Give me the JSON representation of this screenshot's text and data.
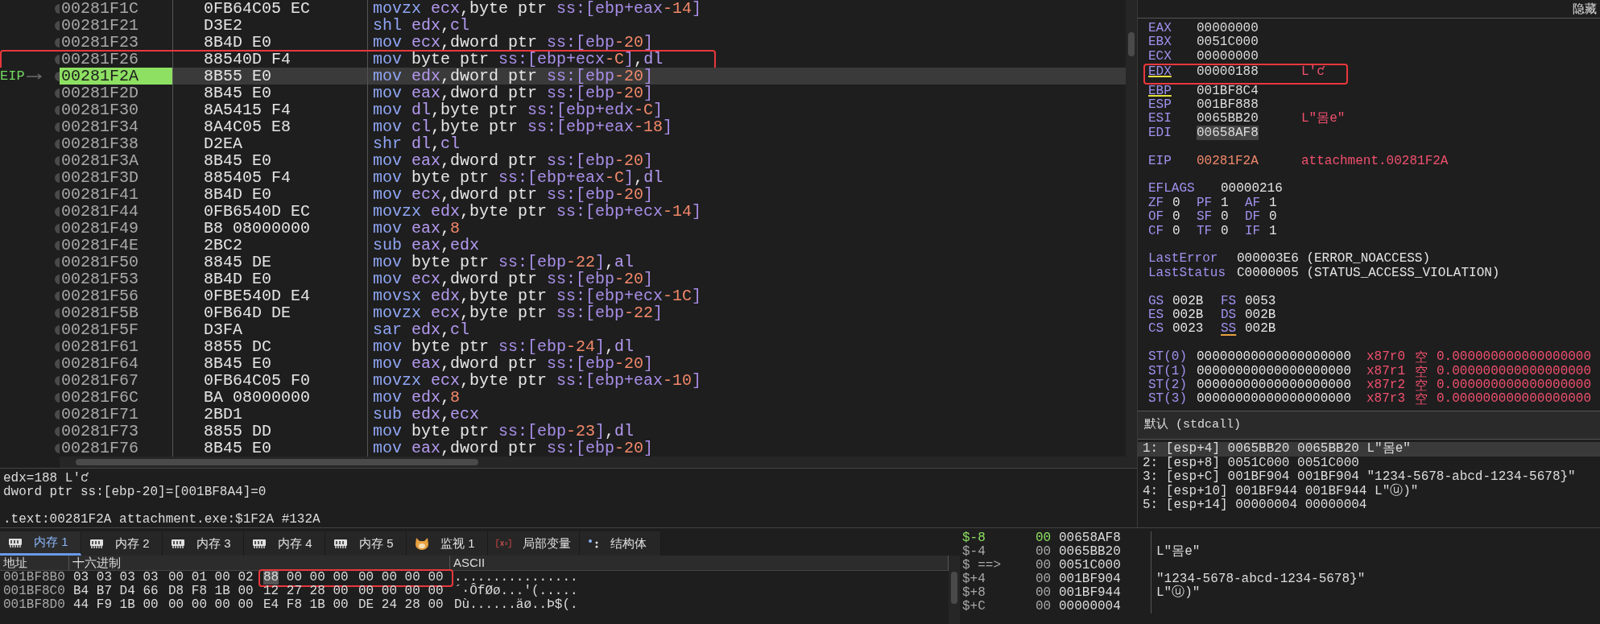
{
  "disassembly": {
    "ip_label": "EIP",
    "rows": [
      {
        "address": "00281F1C",
        "bytes": "0FB64C05 EC",
        "current": false,
        "annotated": false,
        "instruction": [
          {
            "kind": "m",
            "text": "movzx "
          },
          {
            "kind": "r",
            "text": "ecx"
          },
          {
            "kind": "p",
            "text": ",byte ptr "
          },
          {
            "kind": "s",
            "text": "ss:[ebp+eax"
          },
          {
            "kind": "n",
            "text": "-14"
          },
          {
            "kind": "s",
            "text": "]"
          }
        ]
      },
      {
        "address": "00281F21",
        "bytes": "D3E2",
        "current": false,
        "annotated": false,
        "instruction": [
          {
            "kind": "m",
            "text": "shl "
          },
          {
            "kind": "r",
            "text": "edx"
          },
          {
            "kind": "p",
            "text": ","
          },
          {
            "kind": "r",
            "text": "cl"
          }
        ]
      },
      {
        "address": "00281F23",
        "bytes": "8B4D E0",
        "current": false,
        "annotated": false,
        "instruction": [
          {
            "kind": "m",
            "text": "mov "
          },
          {
            "kind": "r",
            "text": "ecx"
          },
          {
            "kind": "p",
            "text": ",dword ptr "
          },
          {
            "kind": "s",
            "text": "ss:[ebp"
          },
          {
            "kind": "n",
            "text": "-20"
          },
          {
            "kind": "s",
            "text": "]"
          }
        ]
      },
      {
        "address": "00281F26",
        "bytes": "88540D F4",
        "current": false,
        "annotated": true,
        "instruction": [
          {
            "kind": "m",
            "text": "mov "
          },
          {
            "kind": "p",
            "text": "byte ptr "
          },
          {
            "kind": "s",
            "text": "ss:[ebp+ecx"
          },
          {
            "kind": "n",
            "text": "-C"
          },
          {
            "kind": "s",
            "text": "]"
          },
          {
            "kind": "p",
            "text": ","
          },
          {
            "kind": "r",
            "text": "dl"
          }
        ]
      },
      {
        "address": "00281F2A",
        "bytes": "8B55 E0",
        "current": true,
        "annotated": false,
        "instruction": [
          {
            "kind": "m",
            "text": "mov "
          },
          {
            "kind": "r",
            "text": "edx"
          },
          {
            "kind": "p",
            "text": ",dword ptr "
          },
          {
            "kind": "s",
            "text": "ss:[ebp"
          },
          {
            "kind": "n",
            "text": "-20"
          },
          {
            "kind": "s",
            "text": "]"
          }
        ]
      },
      {
        "address": "00281F2D",
        "bytes": "8B45 E0",
        "current": false,
        "annotated": false,
        "instruction": [
          {
            "kind": "m",
            "text": "mov "
          },
          {
            "kind": "r",
            "text": "eax"
          },
          {
            "kind": "p",
            "text": ",dword ptr "
          },
          {
            "kind": "s",
            "text": "ss:[ebp"
          },
          {
            "kind": "n",
            "text": "-20"
          },
          {
            "kind": "s",
            "text": "]"
          }
        ]
      },
      {
        "address": "00281F30",
        "bytes": "8A5415 F4",
        "current": false,
        "annotated": false,
        "instruction": [
          {
            "kind": "m",
            "text": "mov "
          },
          {
            "kind": "r",
            "text": "dl"
          },
          {
            "kind": "p",
            "text": ",byte ptr "
          },
          {
            "kind": "s",
            "text": "ss:[ebp+edx"
          },
          {
            "kind": "n",
            "text": "-C"
          },
          {
            "kind": "s",
            "text": "]"
          }
        ]
      },
      {
        "address": "00281F34",
        "bytes": "8A4C05 E8",
        "current": false,
        "annotated": false,
        "instruction": [
          {
            "kind": "m",
            "text": "mov "
          },
          {
            "kind": "r",
            "text": "cl"
          },
          {
            "kind": "p",
            "text": ",byte ptr "
          },
          {
            "kind": "s",
            "text": "ss:[ebp+eax"
          },
          {
            "kind": "n",
            "text": "-18"
          },
          {
            "kind": "s",
            "text": "]"
          }
        ]
      },
      {
        "address": "00281F38",
        "bytes": "D2EA",
        "current": false,
        "annotated": false,
        "instruction": [
          {
            "kind": "m",
            "text": "shr "
          },
          {
            "kind": "r",
            "text": "dl"
          },
          {
            "kind": "p",
            "text": ","
          },
          {
            "kind": "r",
            "text": "cl"
          }
        ]
      },
      {
        "address": "00281F3A",
        "bytes": "8B45 E0",
        "current": false,
        "annotated": false,
        "instruction": [
          {
            "kind": "m",
            "text": "mov "
          },
          {
            "kind": "r",
            "text": "eax"
          },
          {
            "kind": "p",
            "text": ",dword ptr "
          },
          {
            "kind": "s",
            "text": "ss:[ebp"
          },
          {
            "kind": "n",
            "text": "-20"
          },
          {
            "kind": "s",
            "text": "]"
          }
        ]
      },
      {
        "address": "00281F3D",
        "bytes": "885405 F4",
        "current": false,
        "annotated": false,
        "instruction": [
          {
            "kind": "m",
            "text": "mov "
          },
          {
            "kind": "p",
            "text": "byte ptr "
          },
          {
            "kind": "s",
            "text": "ss:[ebp+eax"
          },
          {
            "kind": "n",
            "text": "-C"
          },
          {
            "kind": "s",
            "text": "]"
          },
          {
            "kind": "p",
            "text": ","
          },
          {
            "kind": "r",
            "text": "dl"
          }
        ]
      },
      {
        "address": "00281F41",
        "bytes": "8B4D E0",
        "current": false,
        "annotated": false,
        "instruction": [
          {
            "kind": "m",
            "text": "mov "
          },
          {
            "kind": "r",
            "text": "ecx"
          },
          {
            "kind": "p",
            "text": ",dword ptr "
          },
          {
            "kind": "s",
            "text": "ss:[ebp"
          },
          {
            "kind": "n",
            "text": "-20"
          },
          {
            "kind": "s",
            "text": "]"
          }
        ]
      },
      {
        "address": "00281F44",
        "bytes": "0FB6540D EC",
        "current": false,
        "annotated": false,
        "instruction": [
          {
            "kind": "m",
            "text": "movzx "
          },
          {
            "kind": "r",
            "text": "edx"
          },
          {
            "kind": "p",
            "text": ",byte ptr "
          },
          {
            "kind": "s",
            "text": "ss:[ebp+ecx"
          },
          {
            "kind": "n",
            "text": "-14"
          },
          {
            "kind": "s",
            "text": "]"
          }
        ]
      },
      {
        "address": "00281F49",
        "bytes": "B8 08000000",
        "current": false,
        "annotated": false,
        "instruction": [
          {
            "kind": "m",
            "text": "mov "
          },
          {
            "kind": "r",
            "text": "eax"
          },
          {
            "kind": "p",
            "text": ","
          },
          {
            "kind": "n",
            "text": "8"
          }
        ]
      },
      {
        "address": "00281F4E",
        "bytes": "2BC2",
        "current": false,
        "annotated": false,
        "instruction": [
          {
            "kind": "m",
            "text": "sub "
          },
          {
            "kind": "r",
            "text": "eax"
          },
          {
            "kind": "p",
            "text": ","
          },
          {
            "kind": "r",
            "text": "edx"
          }
        ]
      },
      {
        "address": "00281F50",
        "bytes": "8845 DE",
        "current": false,
        "annotated": false,
        "instruction": [
          {
            "kind": "m",
            "text": "mov "
          },
          {
            "kind": "p",
            "text": "byte ptr "
          },
          {
            "kind": "s",
            "text": "ss:[ebp"
          },
          {
            "kind": "n",
            "text": "-22"
          },
          {
            "kind": "s",
            "text": "]"
          },
          {
            "kind": "p",
            "text": ","
          },
          {
            "kind": "r",
            "text": "al"
          }
        ]
      },
      {
        "address": "00281F53",
        "bytes": "8B4D E0",
        "current": false,
        "annotated": false,
        "instruction": [
          {
            "kind": "m",
            "text": "mov "
          },
          {
            "kind": "r",
            "text": "ecx"
          },
          {
            "kind": "p",
            "text": ",dword ptr "
          },
          {
            "kind": "s",
            "text": "ss:[ebp"
          },
          {
            "kind": "n",
            "text": "-20"
          },
          {
            "kind": "s",
            "text": "]"
          }
        ]
      },
      {
        "address": "00281F56",
        "bytes": "0FBE540D E4",
        "current": false,
        "annotated": false,
        "instruction": [
          {
            "kind": "m",
            "text": "movsx "
          },
          {
            "kind": "r",
            "text": "edx"
          },
          {
            "kind": "p",
            "text": ",byte ptr "
          },
          {
            "kind": "s",
            "text": "ss:[ebp+ecx"
          },
          {
            "kind": "n",
            "text": "-1C"
          },
          {
            "kind": "s",
            "text": "]"
          }
        ]
      },
      {
        "address": "00281F5B",
        "bytes": "0FB64D DE",
        "current": false,
        "annotated": false,
        "instruction": [
          {
            "kind": "m",
            "text": "movzx "
          },
          {
            "kind": "r",
            "text": "ecx"
          },
          {
            "kind": "p",
            "text": ",byte ptr "
          },
          {
            "kind": "s",
            "text": "ss:[ebp"
          },
          {
            "kind": "n",
            "text": "-22"
          },
          {
            "kind": "s",
            "text": "]"
          }
        ]
      },
      {
        "address": "00281F5F",
        "bytes": "D3FA",
        "current": false,
        "annotated": false,
        "instruction": [
          {
            "kind": "m",
            "text": "sar "
          },
          {
            "kind": "r",
            "text": "edx"
          },
          {
            "kind": "p",
            "text": ","
          },
          {
            "kind": "r",
            "text": "cl"
          }
        ]
      },
      {
        "address": "00281F61",
        "bytes": "8855 DC",
        "current": false,
        "annotated": false,
        "instruction": [
          {
            "kind": "m",
            "text": "mov "
          },
          {
            "kind": "p",
            "text": "byte ptr "
          },
          {
            "kind": "s",
            "text": "ss:[ebp"
          },
          {
            "kind": "n",
            "text": "-24"
          },
          {
            "kind": "s",
            "text": "]"
          },
          {
            "kind": "p",
            "text": ","
          },
          {
            "kind": "r",
            "text": "dl"
          }
        ]
      },
      {
        "address": "00281F64",
        "bytes": "8B45 E0",
        "current": false,
        "annotated": false,
        "instruction": [
          {
            "kind": "m",
            "text": "mov "
          },
          {
            "kind": "r",
            "text": "eax"
          },
          {
            "kind": "p",
            "text": ",dword ptr "
          },
          {
            "kind": "s",
            "text": "ss:[ebp"
          },
          {
            "kind": "n",
            "text": "-20"
          },
          {
            "kind": "s",
            "text": "]"
          }
        ]
      },
      {
        "address": "00281F67",
        "bytes": "0FB64C05 F0",
        "current": false,
        "annotated": false,
        "instruction": [
          {
            "kind": "m",
            "text": "movzx "
          },
          {
            "kind": "r",
            "text": "ecx"
          },
          {
            "kind": "p",
            "text": ",byte ptr "
          },
          {
            "kind": "s",
            "text": "ss:[ebp+eax"
          },
          {
            "kind": "n",
            "text": "-10"
          },
          {
            "kind": "s",
            "text": "]"
          }
        ]
      },
      {
        "address": "00281F6C",
        "bytes": "BA 08000000",
        "current": false,
        "annotated": false,
        "instruction": [
          {
            "kind": "m",
            "text": "mov "
          },
          {
            "kind": "r",
            "text": "edx"
          },
          {
            "kind": "p",
            "text": ","
          },
          {
            "kind": "n",
            "text": "8"
          }
        ]
      },
      {
        "address": "00281F71",
        "bytes": "2BD1",
        "current": false,
        "annotated": false,
        "instruction": [
          {
            "kind": "m",
            "text": "sub "
          },
          {
            "kind": "r",
            "text": "edx"
          },
          {
            "kind": "p",
            "text": ","
          },
          {
            "kind": "r",
            "text": "ecx"
          }
        ]
      },
      {
        "address": "00281F73",
        "bytes": "8855 DD",
        "current": false,
        "annotated": false,
        "instruction": [
          {
            "kind": "m",
            "text": "mov "
          },
          {
            "kind": "p",
            "text": "byte ptr "
          },
          {
            "kind": "s",
            "text": "ss:[ebp"
          },
          {
            "kind": "n",
            "text": "-23"
          },
          {
            "kind": "s",
            "text": "]"
          },
          {
            "kind": "p",
            "text": ","
          },
          {
            "kind": "r",
            "text": "dl"
          }
        ]
      },
      {
        "address": "00281F76",
        "bytes": "8B45 E0",
        "current": false,
        "annotated": false,
        "instruction": [
          {
            "kind": "m",
            "text": "mov "
          },
          {
            "kind": "r",
            "text": "eax"
          },
          {
            "kind": "p",
            "text": ",dword ptr "
          },
          {
            "kind": "s",
            "text": "ss:[ebp"
          },
          {
            "kind": "n",
            "text": "-20"
          },
          {
            "kind": "s",
            "text": "]"
          }
        ]
      }
    ]
  },
  "info": {
    "lines": [
      "edx=188 L'ƈ",
      "dword ptr ss:[ebp-20]=[001BF8A4]=0"
    ],
    "location": ".text:00281F2A attachment.exe:$1F2A #132A"
  },
  "registers": {
    "hide_button": "隐藏",
    "general": [
      {
        "name": "EAX",
        "value": "00000000",
        "underlined": false,
        "highlighted": false,
        "annotated": false
      },
      {
        "name": "EBX",
        "value": "0051C000",
        "underlined": false,
        "highlighted": false,
        "annotated": false
      },
      {
        "name": "ECX",
        "value": "00000000",
        "underlined": false,
        "highlighted": false,
        "annotated": false
      },
      {
        "name": "EDX",
        "value": "00000188",
        "comment": "L'ƈ",
        "underlined": true,
        "highlighted": false,
        "annotated": true
      },
      {
        "name": "EBP",
        "value": "001BF8C4",
        "underlined": true,
        "highlighted": false,
        "annotated": false
      },
      {
        "name": "ESP",
        "value": "001BF888",
        "underlined": false,
        "highlighted": false,
        "annotated": false
      },
      {
        "name": "ESI",
        "value": "0065BB20",
        "comment": "L\"몸e\"",
        "underlined": false,
        "highlighted": false,
        "annotated": false
      },
      {
        "name": "EDI",
        "value": "00658AF8",
        "underlined": false,
        "highlighted": true,
        "annotated": false
      }
    ],
    "eip": {
      "name": "EIP",
      "value": "00281F2A",
      "comment": "attachment.00281F2A"
    },
    "eflags": {
      "name": "EFLAGS",
      "value": "00000216",
      "flags": [
        {
          "name": "ZF",
          "value": "0"
        },
        {
          "name": "PF",
          "value": "1"
        },
        {
          "name": "AF",
          "value": "1"
        },
        {
          "name": "OF",
          "value": "0"
        },
        {
          "name": "SF",
          "value": "0"
        },
        {
          "name": "DF",
          "value": "0"
        },
        {
          "name": "CF",
          "value": "0"
        },
        {
          "name": "TF",
          "value": "0"
        },
        {
          "name": "IF",
          "value": "1"
        }
      ]
    },
    "status": [
      {
        "name": "LastError",
        "value": "000003E6 (ERROR_NOACCESS)"
      },
      {
        "name": "LastStatus",
        "value": "C0000005 (STATUS_ACCESS_VIOLATION)"
      }
    ],
    "segments": [
      {
        "name": "GS",
        "value": "002B",
        "underlined": false
      },
      {
        "name": "FS",
        "value": "0053",
        "underlined": false
      },
      {
        "name": "ES",
        "value": "002B",
        "underlined": false
      },
      {
        "name": "DS",
        "value": "002B",
        "underlined": false
      },
      {
        "name": "CS",
        "value": "0023",
        "underlined": false
      },
      {
        "name": "SS",
        "value": "002B",
        "underlined": true
      }
    ],
    "fpu": [
      {
        "name": "ST(0)",
        "value": "00000000000000000000",
        "tag": "x87r0",
        "state": "空",
        "float": "0.000000000000000000"
      },
      {
        "name": "ST(1)",
        "value": "00000000000000000000",
        "tag": "x87r1",
        "state": "空",
        "float": "0.000000000000000000"
      },
      {
        "name": "ST(2)",
        "value": "00000000000000000000",
        "tag": "x87r2",
        "state": "空",
        "float": "0.000000000000000000"
      },
      {
        "name": "ST(3)",
        "value": "00000000000000000000",
        "tag": "x87r3",
        "state": "空",
        "float": "0.000000000000000000"
      }
    ]
  },
  "call_stack": {
    "convention": "默认 (stdcall)",
    "args": [
      {
        "text": "1: [esp+4] 0065BB20 0065BB20 L\"몸e\"",
        "selected": true
      },
      {
        "text": "2: [esp+8] 0051C000 0051C000",
        "selected": false
      },
      {
        "text": "3: [esp+C] 001BF904 001BF904 \"1234-5678-abcd-1234-5678}\"",
        "selected": false
      },
      {
        "text": "4: [esp+10] 001BF944 001BF944 L\"ⓤ)\"",
        "selected": false
      },
      {
        "text": "5: [esp+14] 00000004 00000004",
        "selected": false
      }
    ]
  },
  "memory": {
    "tabs": [
      {
        "label": "内存 1",
        "kind": "memory",
        "selected": true
      },
      {
        "label": "内存 2",
        "kind": "memory",
        "selected": false
      },
      {
        "label": "内存 3",
        "kind": "memory",
        "selected": false
      },
      {
        "label": "内存 4",
        "kind": "memory",
        "selected": false
      },
      {
        "label": "内存 5",
        "kind": "memory",
        "selected": false
      },
      {
        "label": "监视 1",
        "kind": "watch",
        "selected": false
      },
      {
        "label": "局部变量",
        "kind": "locals",
        "selected": false
      },
      {
        "label": "结构体",
        "kind": "struct",
        "selected": false
      }
    ],
    "columns": [
      "地址",
      "十六进制",
      "ASCII"
    ],
    "rows": [
      {
        "address": "001BF8B0",
        "annotated": true,
        "ascii": "................",
        "bytes": [
          {
            "value": "03",
            "selected": false
          },
          {
            "value": "03",
            "selected": false
          },
          {
            "value": "03",
            "selected": false
          },
          {
            "value": "03",
            "selected": false
          },
          {
            "value": "00",
            "selected": false
          },
          {
            "value": "01",
            "selected": false
          },
          {
            "value": "00",
            "selected": false
          },
          {
            "value": "02",
            "selected": false
          },
          {
            "value": "88",
            "selected": true
          },
          {
            "value": "00",
            "selected": false
          },
          {
            "value": "00",
            "selected": false
          },
          {
            "value": "00",
            "selected": false
          },
          {
            "value": "00",
            "selected": false
          },
          {
            "value": "00",
            "selected": false
          },
          {
            "value": "00",
            "selected": false
          },
          {
            "value": "00",
            "selected": false
          }
        ]
      },
      {
        "address": "001BF8C0",
        "annotated": false,
        "ascii": "´·ÔfØø...'(.....",
        "bytes": [
          {
            "value": "B4",
            "selected": false
          },
          {
            "value": "B7",
            "selected": false
          },
          {
            "value": "D4",
            "selected": false
          },
          {
            "value": "66",
            "selected": false
          },
          {
            "value": "D8",
            "selected": false
          },
          {
            "value": "F8",
            "selected": false
          },
          {
            "value": "1B",
            "selected": false
          },
          {
            "value": "00",
            "selected": false
          },
          {
            "value": "12",
            "selected": false
          },
          {
            "value": "27",
            "selected": false
          },
          {
            "value": "28",
            "selected": false
          },
          {
            "value": "00",
            "selected": false
          },
          {
            "value": "00",
            "selected": false
          },
          {
            "value": "00",
            "selected": false
          },
          {
            "value": "00",
            "selected": false
          },
          {
            "value": "00",
            "selected": false
          }
        ]
      },
      {
        "address": "001BF8D0",
        "annotated": false,
        "ascii": "Dù......äø..Þ$(.",
        "bytes": [
          {
            "value": "44",
            "selected": false
          },
          {
            "value": "F9",
            "selected": false
          },
          {
            "value": "1B",
            "selected": false
          },
          {
            "value": "00",
            "selected": false
          },
          {
            "value": "00",
            "selected": false
          },
          {
            "value": "00",
            "selected": false
          },
          {
            "value": "00",
            "selected": false
          },
          {
            "value": "00",
            "selected": false
          },
          {
            "value": "E4",
            "selected": false
          },
          {
            "value": "F8",
            "selected": false
          },
          {
            "value": "1B",
            "selected": false
          },
          {
            "value": "00",
            "selected": false
          },
          {
            "value": "DE",
            "selected": false
          },
          {
            "value": "24",
            "selected": false
          },
          {
            "value": "28",
            "selected": false
          },
          {
            "value": "00",
            "selected": false
          }
        ]
      }
    ]
  },
  "stack": {
    "rows": [
      {
        "offset": "$-8",
        "marker": "00",
        "value": "00658AF8",
        "current": true
      },
      {
        "offset": "$-4",
        "marker": "00",
        "value": "0065BB20",
        "comment": "L\"몸e\"",
        "current": false
      },
      {
        "offset": "$ ==>",
        "marker": "00",
        "value": "0051C000",
        "current": false
      },
      {
        "offset": "$+4",
        "marker": "00",
        "value": "001BF904",
        "comment": "\"1234-5678-abcd-1234-5678}\"",
        "current": false
      },
      {
        "offset": "$+8",
        "marker": "00",
        "value": "001BF944",
        "comment": "L\"ⓤ)\"",
        "current": false
      },
      {
        "offset": "$+C",
        "marker": "00",
        "value": "00000004",
        "current": false
      }
    ]
  }
}
